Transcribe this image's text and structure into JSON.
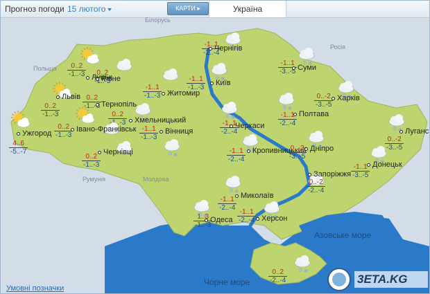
{
  "header": {
    "title": "Прогноз погоди",
    "date": "15 лютого",
    "maps_button": "КАРТИ",
    "tab_region": "Україна"
  },
  "background_labels": [
    "Білорусь",
    "Польща",
    "Росія",
    "Румунія",
    "Молдова"
  ],
  "seas": [
    "Азовське море",
    "Чорне море"
  ],
  "legend_link": "Умовні позначки",
  "logo_text": "3ETA.KG",
  "cities": [
    {
      "name": "Чернігів",
      "day": "-1..1",
      "night": "-2..-4",
      "icon": "cloud-snow-icon"
    },
    {
      "name": "Київ",
      "day": "-1..1",
      "night": "-1..-3",
      "icon": "cloud-snow-icon"
    },
    {
      "name": "Луцьк",
      "day": "0..2",
      "night": "-1..-3",
      "icon": "sun-cloud-icon"
    },
    {
      "name": "Рівне",
      "day": "0..2",
      "night": "-1..-3",
      "icon": "cloud-icon"
    },
    {
      "name": "Житомир",
      "day": "-1..1",
      "night": "-1..-3",
      "icon": "cloud-icon"
    },
    {
      "name": "Львів",
      "day": "0..2",
      "night": "-1..-3",
      "icon": "sun-cloud-icon"
    },
    {
      "name": "Тернопіль",
      "day": "0..2",
      "night": "-1..-3",
      "icon": "sun-cloud-icon"
    },
    {
      "name": "Хмельницький",
      "day": "0..2",
      "night": "-1..-3",
      "icon": "cloud-snow-icon"
    },
    {
      "name": "Вінниця",
      "day": "-1..1",
      "night": "-1..-3",
      "icon": "cloud-snow-icon"
    },
    {
      "name": "Ужгород",
      "day": "4..6",
      "night": "-5..-7",
      "icon": "sun-cloud-icon"
    },
    {
      "name": "Івано-Франківськ",
      "day": "0..2",
      "night": "-1..-3",
      "icon": "cloud-icon"
    },
    {
      "name": "Чернівці",
      "day": "0..2",
      "night": "-1..-3",
      "icon": "cloud-icon"
    },
    {
      "name": "Суми",
      "day": "-1..1",
      "night": "-3..-5",
      "icon": "cloud-snow-icon"
    },
    {
      "name": "Харків",
      "day": "0..-2",
      "night": "-3..-5",
      "icon": "cloud-snow-icon"
    },
    {
      "name": "Полтава",
      "day": "-1..1",
      "night": "-2..-4",
      "icon": "cloud-snow-icon"
    },
    {
      "name": "Черкаси",
      "day": "-1..1",
      "night": "-2..-4",
      "icon": "cloud-snow-icon"
    },
    {
      "name": "Луганськ",
      "day": "0..-2",
      "night": "-3..-5",
      "icon": "cloud-snow-icon"
    },
    {
      "name": "Кропивницький",
      "day": "-1..1",
      "night": "-2..-4",
      "icon": "cloud-snow-icon"
    },
    {
      "name": "Дніпро",
      "day": "0..-2",
      "night": "-3..-5",
      "icon": "cloud-snow-icon"
    },
    {
      "name": "Донецьк",
      "day": "-1..1",
      "night": "-3..-5",
      "icon": "cloud-snow-icon"
    },
    {
      "name": "Запоріжжя",
      "day": "0..-2",
      "night": "-2..-4",
      "icon": "cloud-icon"
    },
    {
      "name": "Миколаїв",
      "day": "-1..1",
      "night": "-2..-4",
      "icon": "cloud-snow-icon"
    },
    {
      "name": "Одеса",
      "day": "1..3",
      "night": "-1..-3",
      "icon": "cloud-snow-icon"
    },
    {
      "name": "Херсон",
      "day": "-1..1",
      "night": "-2..-4",
      "icon": "cloud-snow-icon"
    },
    {
      "name": "",
      "day": "0..2",
      "night": "-2..-4",
      "icon": "cloud-snow-icon"
    }
  ],
  "colors": {
    "land": "#bed56f",
    "water": "#2b79c9",
    "neighbor": "#d5dee6",
    "day_temp": "#c0241c",
    "night_temp": "#1a4f8a"
  }
}
